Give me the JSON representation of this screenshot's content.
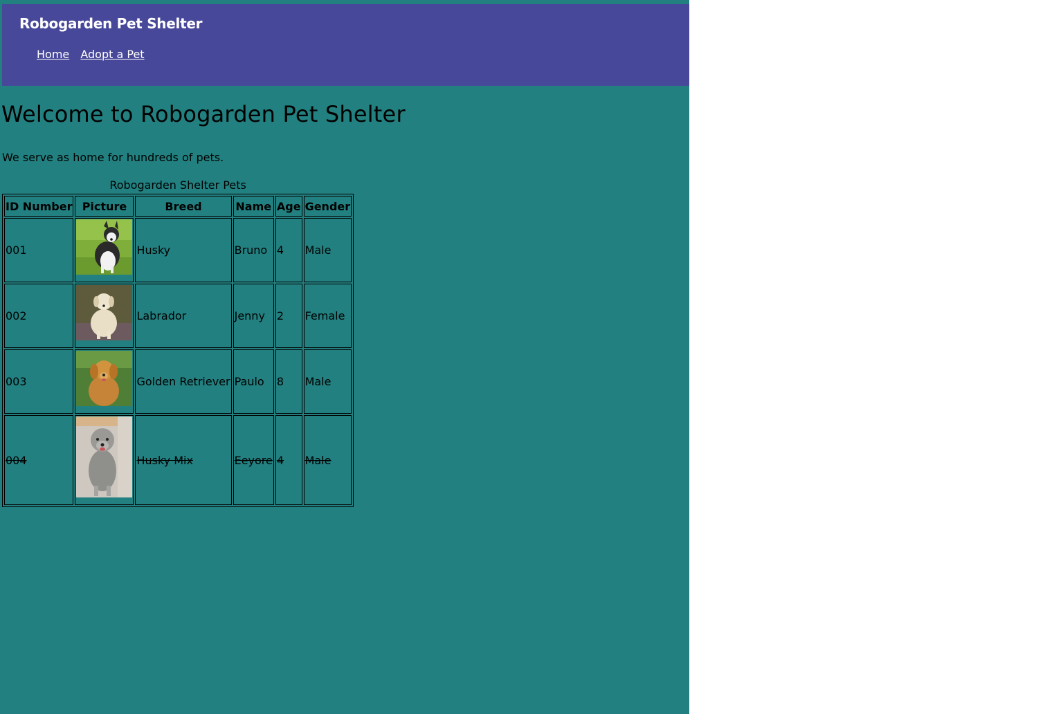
{
  "header": {
    "site_title": "Robogarden Pet Shelter",
    "nav": [
      {
        "label": "Home"
      },
      {
        "label": "Adopt a Pet"
      }
    ]
  },
  "main": {
    "heading": "Welcome to Robogarden Pet Shelter",
    "intro": "We serve as home for hundreds of pets.",
    "table": {
      "caption": "Robogarden Shelter Pets",
      "columns": [
        "ID Number",
        "Picture",
        "Breed",
        "Name",
        "Age",
        "Gender"
      ],
      "rows": [
        {
          "id": "001",
          "picture": "husky-photo",
          "breed": "Husky",
          "name": "Bruno",
          "age": "4",
          "gender": "Male",
          "adopted": false
        },
        {
          "id": "002",
          "picture": "labrador-photo",
          "breed": "Labrador",
          "name": "Jenny",
          "age": "2",
          "gender": "Female",
          "adopted": false
        },
        {
          "id": "003",
          "picture": "golden-retriever-photo",
          "breed": "Golden Retriever",
          "name": "Paulo",
          "age": "8",
          "gender": "Male",
          "adopted": false
        },
        {
          "id": "004",
          "picture": "husky-mix-photo",
          "breed": "Husky Mix",
          "name": "Eeyore",
          "age": "4",
          "gender": "Male",
          "adopted": true
        }
      ]
    }
  },
  "colors": {
    "page_background": "#238080",
    "header_background": "#48489a",
    "outer_background": "#ffffff"
  }
}
